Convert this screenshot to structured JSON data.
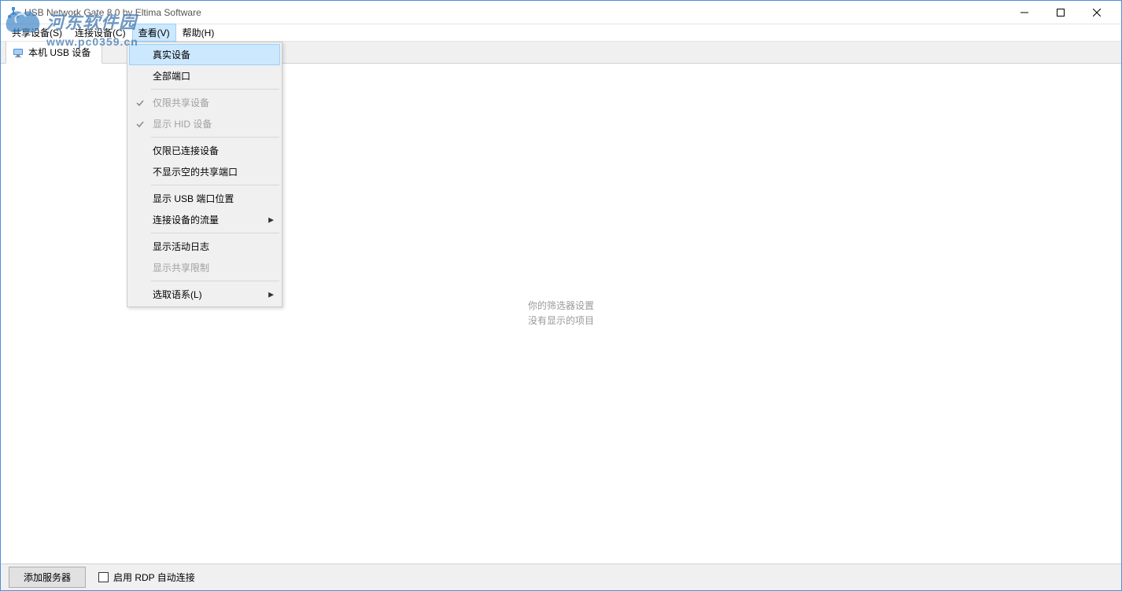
{
  "window": {
    "title": "USB Network Gate 8.0 by Eltima Software"
  },
  "menubar": {
    "items": [
      {
        "label": "共享设备(S)"
      },
      {
        "label": "连接设备(C)"
      },
      {
        "label": "查看(V)"
      },
      {
        "label": "帮助(H)"
      }
    ]
  },
  "tab": {
    "label": "本机 USB 设备"
  },
  "dropdown": {
    "items": [
      {
        "label": "真实设备",
        "highlight": true
      },
      {
        "label": "全部端口"
      },
      {
        "sep": true
      },
      {
        "label": "仅限共享设备",
        "check": true,
        "disabled": true
      },
      {
        "label": "显示 HID 设备",
        "check": true,
        "disabled": true
      },
      {
        "sep": true
      },
      {
        "label": "仅限已连接设备"
      },
      {
        "label": "不显示空的共享端口"
      },
      {
        "sep": true
      },
      {
        "label": "显示 USB 端口位置"
      },
      {
        "label": "连接设备的流量",
        "submenu": true
      },
      {
        "sep": true
      },
      {
        "label": "显示活动日志"
      },
      {
        "label": "显示共享限制",
        "disabled": true
      },
      {
        "sep": true
      },
      {
        "label": "选取语系(L)",
        "submenu": true
      }
    ]
  },
  "empty": {
    "line1": "你的筛选器设置",
    "line2": "没有显示的项目"
  },
  "bottom": {
    "add_server": "添加服务器",
    "rdp_label": "启用 RDP 自动连接"
  },
  "watermark": {
    "text": "河东软件园",
    "url": "www.pc0359.cn"
  }
}
